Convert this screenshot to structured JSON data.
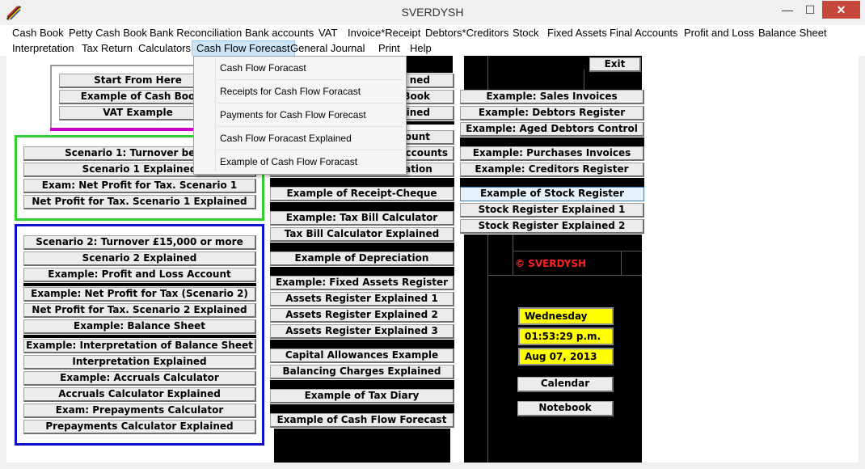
{
  "window": {
    "title": "SVERDYSH",
    "minimize": "—",
    "maximize": "☐",
    "close": "✕"
  },
  "menu": {
    "row1": [
      "Cash Book",
      "Petty Cash Book",
      "Bank Reconciliation",
      "Bank accounts",
      "VAT",
      "Invoice*Receipt",
      "Debtors*Creditors",
      "Stock",
      "Fixed Assets",
      "Final Accounts",
      "Profit and Loss",
      "Balance Sheet"
    ],
    "row2": [
      "Interpretation",
      "Tax Return",
      "Calculators",
      "Cash Flow Forecast",
      "General Journal",
      "Print",
      "Help"
    ]
  },
  "dropdown": [
    "Cash Flow Foracast",
    "Receipts for Cash Flow Foracast",
    "Payments for Cash Flow Forecast",
    "Cash Flow Foracast Explained",
    "Example of Cash Flow Foracast"
  ],
  "col1": {
    "top": [
      "Start From Here",
      "Example of Cash Boo",
      "VAT Example"
    ],
    "green": [
      "Scenario 1: Turnover below",
      "Scenario 1 Explained",
      "Exam: Net Profit for Tax. Scenario 1",
      "Net Profit for Tax. Scenario 1 Explained"
    ],
    "blue": [
      "Scenario 2: Turnover £15,000 or more",
      "Scenario 2 Explained",
      "Example: Profit and Loss Account",
      "Example: Net Profit for Tax (Scenario 2)",
      "Net Profit for Tax. Scenario 2 Explained",
      "Example: Balance Sheet",
      "Example: Interpretation of Balance Sheet",
      "Interpretation Explained",
      "Example: Accruals Calculator",
      "Accruals Calculator Explained",
      "Exam: Prepayments Calculator",
      "Prepayments Calculator Explained"
    ]
  },
  "col2": {
    "partial": [
      "ned",
      "Book",
      "ained",
      "ount",
      "Accounts",
      "Example of Reconciliation"
    ],
    "buttons": [
      "Example of Receipt-Cheque",
      "Example: Tax Bill Calculator",
      "Tax Bill Calculator Explained",
      "Example of Depreciation",
      "Example: Fixed Assets Register",
      "Assets Register Explained 1",
      "Assets Register Explained 2",
      "Assets Register Explained 3",
      "Capital Allowances Example",
      "Balancing Charges Explained",
      "Example of Tax Diary",
      "Example of Cash Flow Forecast"
    ]
  },
  "col3": {
    "exit": "Exit",
    "buttons": [
      "Example: Sales Invoices",
      "Example: Debtors Register",
      "Example: Aged Debtors Control",
      "Example: Purchases Invoices",
      "Example: Creditors Register",
      "Example of Stock Register",
      "Stock Register Explained 1",
      "Stock Register Explained 2"
    ]
  },
  "panel": {
    "copyright": "© SVERDYSH",
    "day": "Wednesday",
    "time": "01:53:29 p.m.",
    "date": "Aug 07, 2013",
    "calendar": "Calendar",
    "notebook": "Notebook"
  },
  "colors": {
    "green_box": "#33cc33",
    "blue_box": "#1010cc",
    "magenta_line": "#cc00cc",
    "highlight": "#cce4f7",
    "clock_bg": "#ffff00",
    "copyright": "#ff2020"
  }
}
